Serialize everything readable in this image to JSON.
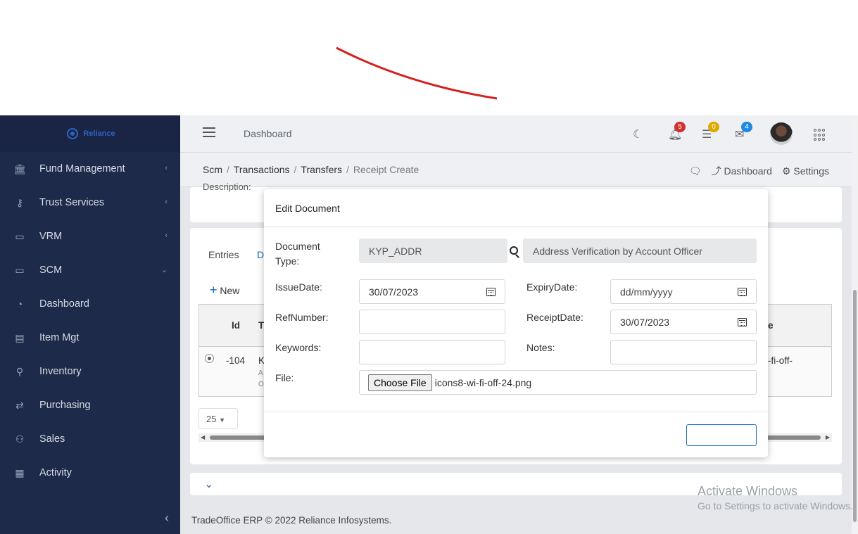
{
  "app": {
    "logo_text": "Reliance",
    "header_title": "Dashboard",
    "notifications": {
      "bell": "5",
      "tasks": "0",
      "mail": "4"
    }
  },
  "sidebar": {
    "items": [
      {
        "label": "Fund Management",
        "icon": "bank-icon",
        "chevron": "‹"
      },
      {
        "label": "Trust Services",
        "icon": "key-icon",
        "chevron": "‹"
      },
      {
        "label": "VRM",
        "icon": "vrm-icon",
        "chevron": "‹"
      },
      {
        "label": "SCM",
        "icon": "scm-icon",
        "chevron": "⌄"
      },
      {
        "label": "Dashboard",
        "icon": "gauge-icon"
      },
      {
        "label": "Item Mgt",
        "icon": "archive-icon"
      },
      {
        "label": "Inventory",
        "icon": "inventory-icon"
      },
      {
        "label": "Purchasing",
        "icon": "exchange-icon"
      },
      {
        "label": "Sales",
        "icon": "people-icon"
      },
      {
        "label": "Activity",
        "icon": "calendar-icon"
      }
    ],
    "collapse": "‹"
  },
  "breadcrumb": {
    "items": [
      "Scm",
      "Transactions",
      "Transfers"
    ],
    "current": "Receipt Create",
    "right": {
      "dashboard": "Dashboard",
      "settings": "Settings"
    }
  },
  "page": {
    "description_label": "Description:",
    "tabs": [
      "Entries",
      "D"
    ],
    "new_label": "New",
    "table": {
      "headers": [
        "Id",
        "T",
        "e"
      ],
      "row": {
        "id": "-104",
        "t": "K",
        "t_sub1": "A",
        "t_sub2": "O",
        "tail": "-fi-off-"
      }
    },
    "page_size": "25"
  },
  "footer": "TradeOffice ERP © 2022 Reliance Infosystems.",
  "modal": {
    "title": "Edit Document",
    "document_type_label": "Document Type:",
    "document_type_code": "KYP_ADDR",
    "document_type_name": "Address Verification by Account Officer",
    "issue_date_label": "IssueDate:",
    "issue_date": "30/07/2023",
    "expiry_date_label": "ExpiryDate:",
    "expiry_date_placeholder": "dd/mm/yyyy",
    "ref_number_label": "RefNumber:",
    "ref_number": "",
    "receipt_date_label": "ReceiptDate:",
    "receipt_date": "30/07/2023",
    "keywords_label": "Keywords:",
    "keywords": "",
    "notes_label": "Notes:",
    "notes": "",
    "file_label": "File:",
    "choose_file": "Choose File",
    "file_name": "icons8-wi-fi-off-24.png",
    "save_label": ""
  },
  "watermark": {
    "line1": "Activate Windows",
    "line2": "Go to Settings to activate Windows."
  }
}
